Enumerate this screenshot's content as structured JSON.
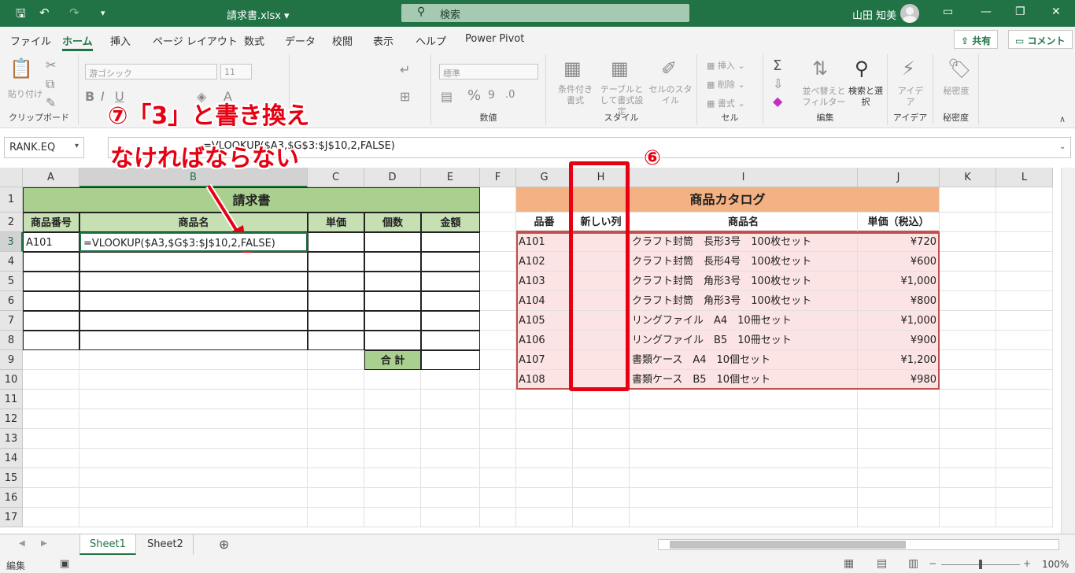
{
  "window": {
    "filename": "請求書.xlsx",
    "search_placeholder": "検索",
    "user_name": "山田 知美"
  },
  "tabs": [
    "ファイル",
    "ホーム",
    "挿入",
    "ページ レイアウト",
    "数式",
    "データ",
    "校閲",
    "表示",
    "ヘルプ",
    "Power Pivot"
  ],
  "share_label": "共有",
  "comment_label": "コメント",
  "ribbon": {
    "clipboard": {
      "paste": "貼り付け",
      "label": "クリップボード"
    },
    "font": {
      "name": "游ゴシック",
      "size": "11"
    },
    "number": {
      "format": "標準",
      "label": "数値"
    },
    "style": {
      "cond": "条件付き書式",
      "table": "テーブルとして書式設定",
      "cell": "セルのスタイル",
      "label": "スタイル"
    },
    "cells": {
      "insert": "挿入",
      "delete": "削除",
      "format": "書式",
      "label": "セル"
    },
    "edit": {
      "sort": "並べ替えとフィルター",
      "find": "検索と選択",
      "label": "編集"
    },
    "ideas": {
      "btn": "アイデア",
      "label": "アイデア"
    },
    "sens": {
      "btn": "秘密度",
      "label": "秘密度"
    }
  },
  "formula_bar": {
    "name_box": "RANK.EQ",
    "formula": "=VLOOKUP($A3,$G$3:$J$10,2,FALSE)"
  },
  "columns": [
    "A",
    "B",
    "C",
    "D",
    "E",
    "F",
    "G",
    "H",
    "I",
    "J",
    "K",
    "L"
  ],
  "rows": [
    "1",
    "2",
    "3",
    "4",
    "5",
    "6",
    "7",
    "8",
    "9",
    "10",
    "11",
    "12",
    "13",
    "14",
    "15",
    "16",
    "17"
  ],
  "invoice": {
    "title": "請求書",
    "headers": [
      "商品番号",
      "商品名",
      "単価",
      "個数",
      "金額"
    ],
    "a3": "A101",
    "b3": "=VLOOKUP($A3,$G$3:$J$10,2,FALSE)",
    "total_label": "合 計"
  },
  "catalog": {
    "title": "商品カタログ",
    "headers": [
      "品番",
      "新しい列",
      "商品名",
      "単価（税込）"
    ],
    "rows": [
      {
        "code": "A101",
        "name": "クラフト封筒　長形3号　100枚セット",
        "price": "¥720"
      },
      {
        "code": "A102",
        "name": "クラフト封筒　長形4号　100枚セット",
        "price": "¥600"
      },
      {
        "code": "A103",
        "name": "クラフト封筒　角形3号　100枚セット",
        "price": "¥1,000"
      },
      {
        "code": "A104",
        "name": "クラフト封筒　角形3号　100枚セット",
        "price": "¥800"
      },
      {
        "code": "A105",
        "name": "リングファイル　A4　10冊セット",
        "price": "¥1,000"
      },
      {
        "code": "A106",
        "name": "リングファイル　B5　10冊セット",
        "price": "¥900"
      },
      {
        "code": "A107",
        "name": "書類ケース　A4　10個セット",
        "price": "¥1,200"
      },
      {
        "code": "A108",
        "name": "書類ケース　B5　10個セット",
        "price": "¥980"
      }
    ]
  },
  "annotations": {
    "note7_line1": "⑦「3」と書き換え",
    "note7_line2": "なければならない",
    "note6": "⑥"
  },
  "sheets": [
    "Sheet1",
    "Sheet2"
  ],
  "status": {
    "mode": "編集",
    "zoom": "100%"
  },
  "colors": {
    "excel_green": "#217346",
    "highlight_red": "#e60012"
  }
}
